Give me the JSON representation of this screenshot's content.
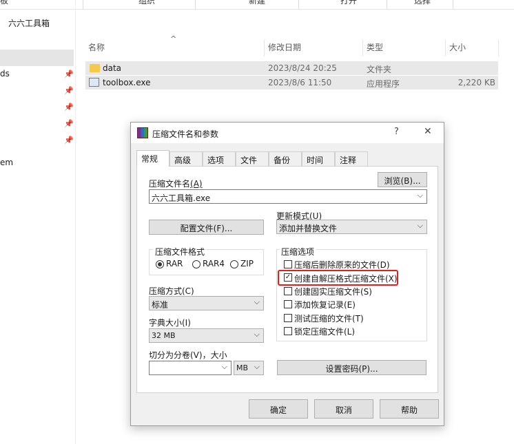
{
  "toolbar": {
    "labels": [
      "板",
      "组织",
      "新建",
      "打开",
      "选择"
    ]
  },
  "address": {
    "path": "六六工具箱"
  },
  "nav": {
    "items": [
      "ds",
      "em"
    ]
  },
  "file_list": {
    "columns": {
      "name": "名称",
      "modified": "修改日期",
      "type": "类型",
      "size": "大小"
    },
    "rows": [
      {
        "name": "data",
        "modified": "2023/8/24 20:25",
        "type": "文件夹",
        "size": ""
      },
      {
        "name": "toolbox.exe",
        "modified": "2023/8/6 11:50",
        "type": "应用程序",
        "size": "2,220 KB"
      }
    ]
  },
  "dialog": {
    "title": "压缩文件名和参数",
    "help_glyph": "?",
    "close_glyph": "✕",
    "tabs": [
      "常规",
      "高级",
      "选项",
      "文件",
      "备份",
      "时间",
      "注释"
    ],
    "archive_name_label": "压缩文件名",
    "archive_name_hotkey": "(A)",
    "browse_button": "浏览(B)...",
    "archive_name_value": "六六工具箱.exe",
    "update_mode_label": "更新模式(U)",
    "update_mode_value": "添加并替换文件",
    "profiles_button": "配置文件(F)...",
    "format_group": "压缩文件格式",
    "formats": [
      "RAR",
      "RAR4",
      "ZIP"
    ],
    "selected_format": "RAR",
    "options_group": "压缩选项",
    "options": [
      {
        "label": "压缩后删除原来的文件(D)",
        "checked": false
      },
      {
        "label": "创建自解压格式压缩文件(X)",
        "checked": true
      },
      {
        "label": "创建固实压缩文件(S)",
        "checked": false
      },
      {
        "label": "添加恢复记录(E)",
        "checked": false
      },
      {
        "label": "测试压缩的文件(T)",
        "checked": false
      },
      {
        "label": "锁定压缩文件(L)",
        "checked": false
      }
    ],
    "method_label": "压缩方式(C)",
    "method_value": "标准",
    "dict_label": "字典大小(I)",
    "dict_value": "32 MB",
    "split_label": "切分为分卷(V)，大小",
    "split_value": "",
    "split_unit": "MB",
    "password_button": "设置密码(P)...",
    "ok": "确定",
    "cancel": "取消",
    "help": "帮助",
    "highlight_color": "#e0201a"
  }
}
